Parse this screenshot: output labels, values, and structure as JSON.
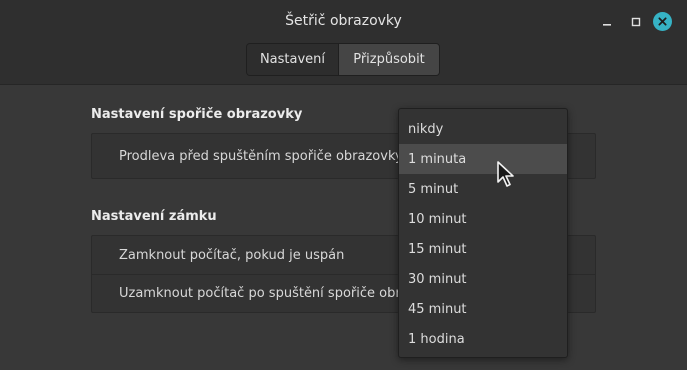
{
  "window": {
    "title": "Šetřič obrazovky",
    "accent_color": "#36b3c5"
  },
  "tabs": [
    {
      "label": "Nastavení",
      "active": true
    },
    {
      "label": "Přizpůsobit",
      "active": false
    }
  ],
  "screensaver_section": {
    "heading": "Nastavení spořiče obrazovky",
    "rows": [
      {
        "label": "Prodleva před spuštěním spořiče obrazovky"
      }
    ]
  },
  "lock_section": {
    "heading": "Nastavení zámku",
    "rows": [
      {
        "label": "Zamknout počítač, pokud je uspán"
      },
      {
        "label": "Uzamknout počítač po spuštění spořiče obrazo"
      }
    ]
  },
  "delay_dropdown": {
    "selected": "1 minuta",
    "options": [
      "nikdy",
      "1 minuta",
      "5 minut",
      "10 minut",
      "15 minut",
      "30 minut",
      "45 minut",
      "1 hodina"
    ]
  }
}
